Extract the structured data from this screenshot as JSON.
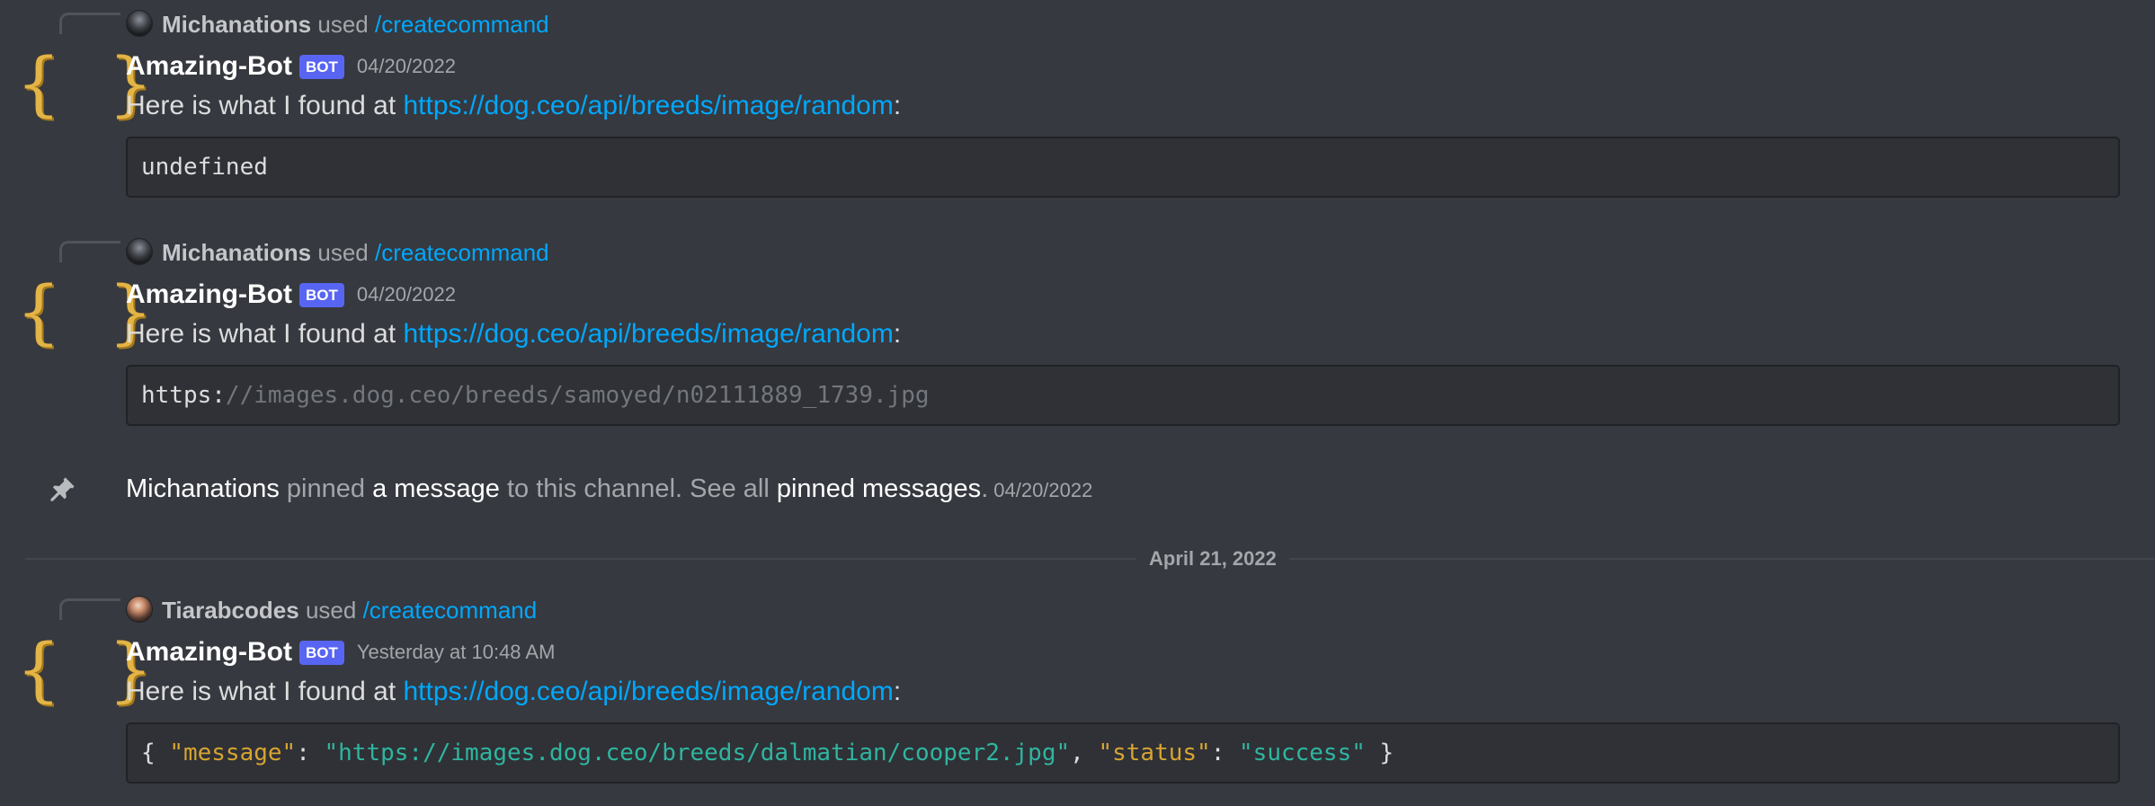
{
  "messages": [
    {
      "reply": {
        "user": "Michanations",
        "used": "used",
        "command": "/createcommand",
        "avatar": "dark-orb-avatar"
      },
      "author": "Amazing-Bot",
      "bot_tag": "BOT",
      "timestamp": "04/20/2022",
      "text_prefix": "Here is what I found at ",
      "link": "https://dog.ceo/api/breeds/image/random",
      "text_suffix": ":",
      "code": {
        "text": "undefined"
      }
    },
    {
      "reply": {
        "user": "Michanations",
        "used": "used",
        "command": "/createcommand",
        "avatar": "dark-orb-avatar"
      },
      "author": "Amazing-Bot",
      "bot_tag": "BOT",
      "timestamp": "04/20/2022",
      "text_prefix": "Here is what I found at ",
      "link": "https://dog.ceo/api/breeds/image/random",
      "text_suffix": ":",
      "code": {
        "part1": "https:",
        "part2": "//images.dog.ceo/breeds/samoyed/n02111889_1739.jpg"
      }
    },
    {
      "reply": {
        "user": "Tiarabcodes",
        "used": "used",
        "command": "/createcommand",
        "avatar": "user-photo-avatar"
      },
      "author": "Amazing-Bot",
      "bot_tag": "BOT",
      "timestamp": "Yesterday at 10:48 AM",
      "text_prefix": "Here is what I found at ",
      "link": "https://dog.ceo/api/breeds/image/random",
      "text_suffix": ":",
      "code": {
        "open": "{ ",
        "key1": "\"message\"",
        "colon1": ": ",
        "val1": "\"https://images.dog.ceo/breeds/dalmatian/cooper2.jpg\"",
        "comma": ", ",
        "key2": "\"status\"",
        "colon2": ": ",
        "val2": "\"success\"",
        "close": " }"
      }
    }
  ],
  "pin_event": {
    "user": "Michanations",
    "pinned": " pinned ",
    "a_message": "a message",
    "mid": " to this channel. See all ",
    "pinned_messages": "pinned messages",
    "end": ".",
    "timestamp": "04/20/2022",
    "icon": "pin-icon"
  },
  "date_divider": "April 21, 2022",
  "colors": {
    "background": "#36393f",
    "link": "#00a8fc",
    "bot_tag": "#5865f2",
    "code_bg": "#2f3136",
    "json_key": "#d7a431",
    "json_string": "#2fb5a0"
  }
}
